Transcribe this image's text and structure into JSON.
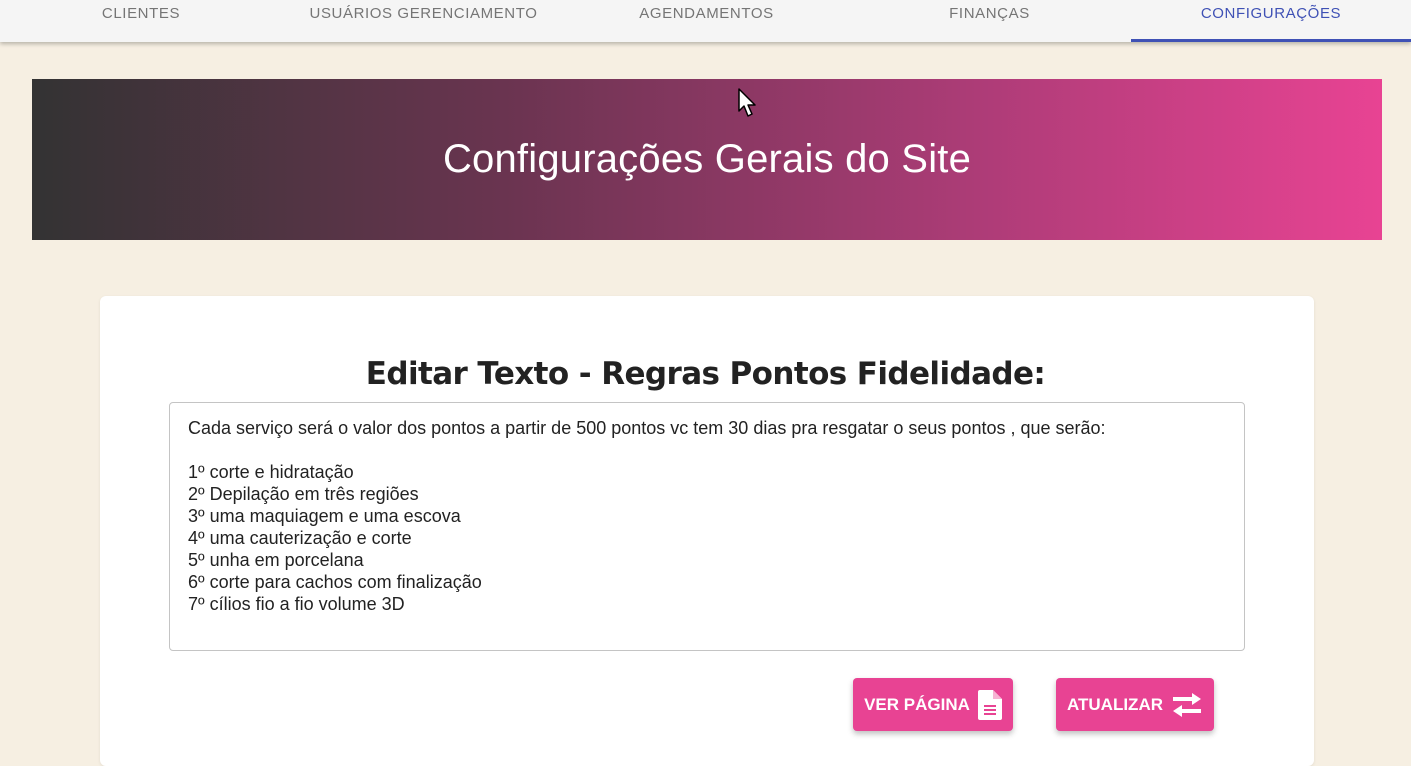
{
  "nav": {
    "tabs": [
      {
        "label": "CLIENTES",
        "active": false
      },
      {
        "label": "USUÁRIOS GERENCIAMENTO",
        "active": false
      },
      {
        "label": "AGENDAMENTOS",
        "active": false
      },
      {
        "label": "FINANÇAS",
        "active": false
      },
      {
        "label": "CONFIGURAÇÕES",
        "active": true
      }
    ],
    "active_color": "#3f51b5"
  },
  "hero": {
    "title": "Configurações Gerais do Site",
    "gradient": [
      "#333333",
      "#e84393"
    ]
  },
  "editor": {
    "title": "Editar Texto - Regras Pontos Fidelidade:",
    "content": "Cada serviço será o valor dos pontos a partir de 500 pontos vc tem 30 dias pra resgatar o seus pontos , que serão:\n\n1º corte e hidratação\n2º Depilação em três regiões\n3º uma maquiagem e uma escova\n4º uma cauterização e corte\n5º unha em porcelana\n6º corte para cachos com finalização\n7º cílios fio a fio volume 3D"
  },
  "actions": {
    "view_label": "VER PÁGINA",
    "view_icon": "document-icon",
    "update_label": "ATUALIZAR",
    "update_icon": "swap-arrows-icon",
    "button_color": "#e84393"
  }
}
